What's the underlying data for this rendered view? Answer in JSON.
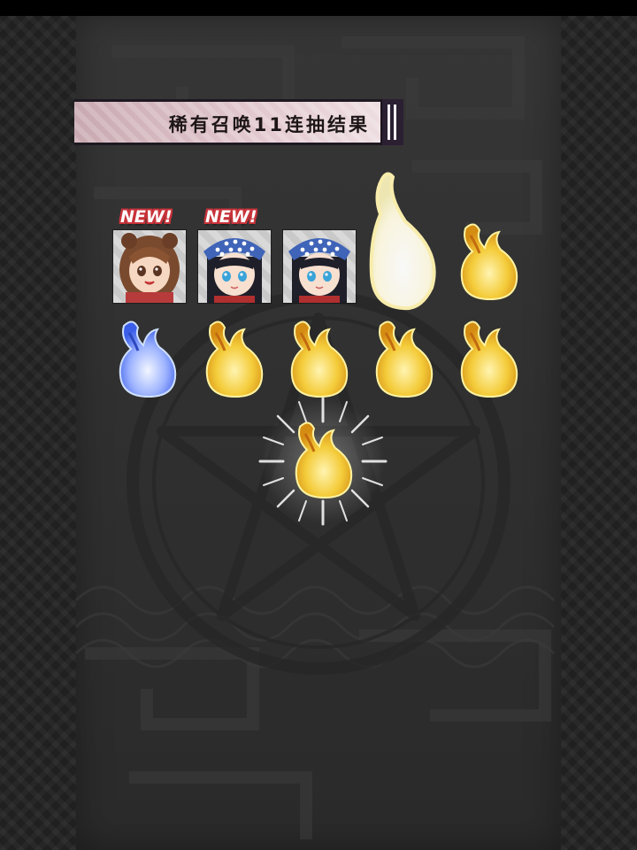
{
  "banner": {
    "title": "稀有召唤11连抽结果"
  },
  "badges": {
    "new_label": "NEW!"
  },
  "colors": {
    "gold": "#f4cc3a",
    "blue": "#6b8cff",
    "white": "#fffde8",
    "badge_outline": "#c8333a"
  },
  "results": [
    {
      "kind": "card",
      "character": "brown-hair-girl",
      "new": true
    },
    {
      "kind": "card",
      "character": "bandana-girl",
      "new": true
    },
    {
      "kind": "card",
      "character": "bandana-girl",
      "new": false
    },
    {
      "kind": "flame",
      "color": "white"
    },
    {
      "kind": "flame",
      "color": "gold"
    },
    {
      "kind": "flame",
      "color": "blue"
    },
    {
      "kind": "flame",
      "color": "gold"
    },
    {
      "kind": "flame",
      "color": "gold"
    },
    {
      "kind": "flame",
      "color": "gold"
    },
    {
      "kind": "flame",
      "color": "gold"
    },
    {
      "kind": "flame",
      "color": "gold",
      "highlighted": true
    }
  ]
}
